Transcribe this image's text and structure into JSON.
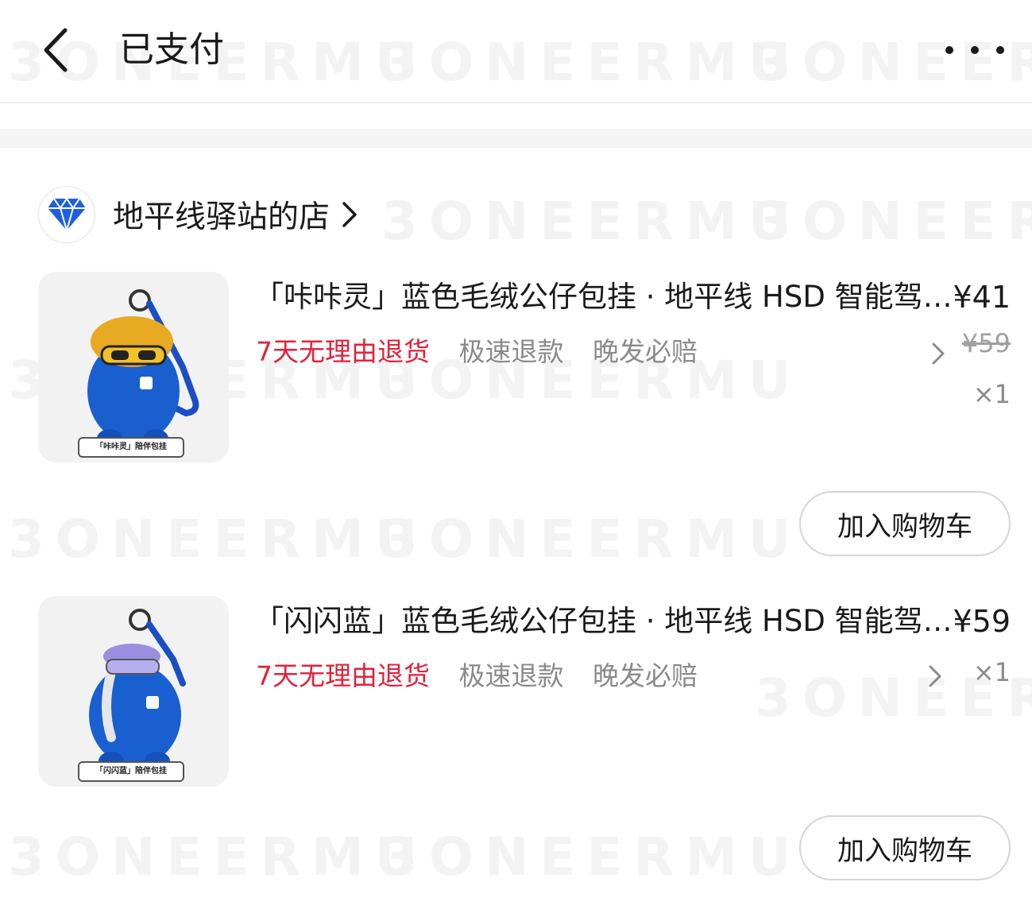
{
  "header": {
    "title": "已支付"
  },
  "shop": {
    "name": "地平线驿站的店"
  },
  "watermark": "3ONEERMU",
  "items": [
    {
      "title": "「咔咔灵」蓝色毛绒公仔包挂 · 地平线 HSD 智能驾驶系统",
      "price": "¥41",
      "original_price": "¥59",
      "quantity": "×1",
      "tags": [
        "7天无理由退货",
        "极速退款",
        "晚发必赔"
      ],
      "thumb_label": "「咔咔灵」陪伴包挂",
      "cart_button": "加入购物车"
    },
    {
      "title": "「闪闪蓝」蓝色毛绒公仔包挂 · 地平线 HSD 智能驾驶系统",
      "price": "¥59",
      "quantity": "×1",
      "tags": [
        "7天无理由退货",
        "极速退款",
        "晚发必赔"
      ],
      "thumb_label": "「闪闪蓝」陪伴包挂",
      "cart_button": "加入购物车"
    }
  ],
  "colors": {
    "accent_red": "#e0223a",
    "muted_gray": "#8a8a8a",
    "plush_blue": "#1a5fd0",
    "hair_yellow": "#e8a923"
  }
}
